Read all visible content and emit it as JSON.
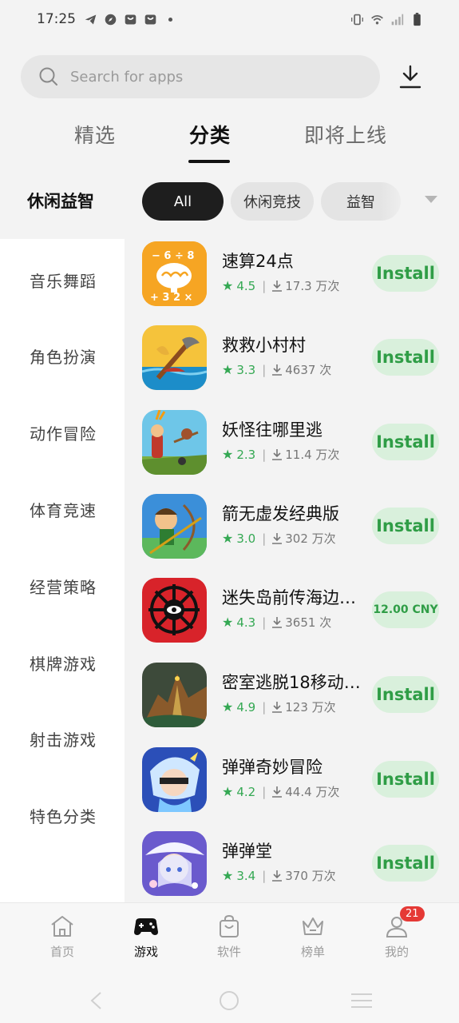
{
  "status": {
    "time": "17:25"
  },
  "search": {
    "placeholder": "Search for apps"
  },
  "top_tabs": [
    {
      "label": "精选"
    },
    {
      "label": "分类"
    },
    {
      "label": "即将上线"
    }
  ],
  "category": {
    "title": "休闲益智",
    "chips": [
      {
        "label": "All"
      },
      {
        "label": "休闲竞技"
      },
      {
        "label": "益智"
      }
    ]
  },
  "sidebar": {
    "items": [
      {
        "label": "音乐舞蹈"
      },
      {
        "label": "角色扮演"
      },
      {
        "label": "动作冒险"
      },
      {
        "label": "体育竞速"
      },
      {
        "label": "经营策略"
      },
      {
        "label": "棋牌游戏"
      },
      {
        "label": "射击游戏"
      },
      {
        "label": "特色分类"
      }
    ]
  },
  "apps": [
    {
      "name": "速算24点",
      "rating": "4.5",
      "downloads": "17.3 万次",
      "action": "Install"
    },
    {
      "name": "救救小村村",
      "rating": "3.3",
      "downloads": "4637 次",
      "action": "Install"
    },
    {
      "name": "妖怪往哪里逃",
      "rating": "2.3",
      "downloads": "11.4 万次",
      "action": "Install"
    },
    {
      "name": "箭无虚发经典版",
      "rating": "3.0",
      "downloads": "302 万次",
      "action": "Install"
    },
    {
      "name": "迷失岛前传海边…",
      "rating": "4.3",
      "downloads": "3651 次",
      "action": "12.00 CNY"
    },
    {
      "name": "密室逃脱18移动…",
      "rating": "4.9",
      "downloads": "123 万次",
      "action": "Install"
    },
    {
      "name": "弹弹奇妙冒险",
      "rating": "4.2",
      "downloads": "44.4 万次",
      "action": "Install"
    },
    {
      "name": "弹弹堂",
      "rating": "3.4",
      "downloads": "370 万次",
      "action": "Install"
    }
  ],
  "bottom_nav": {
    "items": [
      {
        "label": "首页"
      },
      {
        "label": "游戏"
      },
      {
        "label": "软件"
      },
      {
        "label": "榜单"
      },
      {
        "label": "我的"
      }
    ],
    "badge": "21"
  },
  "colors": {
    "accent_green": "#34a853",
    "install_bg": "#d9f0dc",
    "badge_red": "#e53935"
  }
}
